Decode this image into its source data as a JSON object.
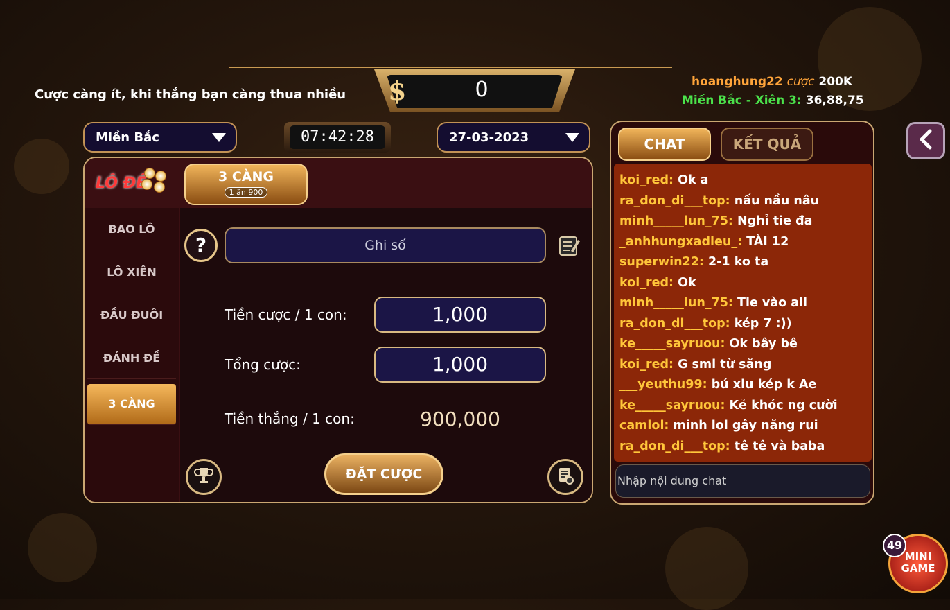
{
  "header": {
    "tagline": "Cược càng ít, khi thắng bạn càng thua nhiều",
    "balance_symbol": "$",
    "balance": "0",
    "ticker": {
      "user": "hoanghung22",
      "bet_word": "cược",
      "bet_amount": "200K",
      "region_line": "Miền Bắc - Xiên 3:",
      "numbers": "36,88,75"
    }
  },
  "controls": {
    "region_selected": "Miền Bắc",
    "timer": "07:42:28",
    "date_selected": "27-03-2023"
  },
  "logo": {
    "text": "LÔ ĐỀ"
  },
  "sidebar": {
    "items": [
      {
        "label": "BAO LÔ",
        "active": false
      },
      {
        "label": "LÔ XIÊN",
        "active": false
      },
      {
        "label": "ĐẦU ĐUÔI",
        "active": false
      },
      {
        "label": "ĐÁNH ĐỀ",
        "active": false
      },
      {
        "label": "3 CÀNG",
        "active": true
      }
    ]
  },
  "bet_panel": {
    "tab_title": "3 CÀNG",
    "tab_subtitle": "1 ăn 900",
    "help_symbol": "?",
    "number_placeholder": "Ghi số",
    "stake_label": "Tiền cược / 1 con:",
    "stake_value": "1,000",
    "total_label": "Tổng cược:",
    "total_value": "1,000",
    "win_label": "Tiền thắng / 1 con:",
    "win_value": "900,000",
    "bet_button": "ĐẶT CƯỢC"
  },
  "chat": {
    "tab_chat": "CHAT",
    "tab_results": "KẾT QUẢ",
    "messages": [
      {
        "user": "koi_red:",
        "text": "Ok a"
      },
      {
        "user": "ra_don_di___top:",
        "text": "nấu nầu nâu"
      },
      {
        "user": "minh_____lun_75:",
        "text": "Nghỉ tie đa"
      },
      {
        "user": "_anhhungxadieu_:",
        "text": "TÀI 12"
      },
      {
        "user": "superwin22:",
        "text": "2-1 ko ta"
      },
      {
        "user": "koi_red:",
        "text": "Ok"
      },
      {
        "user": "minh_____lun_75:",
        "text": "Tie vào all"
      },
      {
        "user": "ra_don_di___top:",
        "text": "kép 7 :))"
      },
      {
        "user": "ke_____sayruou:",
        "text": "Ok bây bê"
      },
      {
        "user": "koi_red:",
        "text": "G sml từ săng"
      },
      {
        "user": "___yeuthu99:",
        "text": "bú xiu kép k Ae"
      },
      {
        "user": "ke_____sayruou:",
        "text": "Kẻ khóc ng cười"
      },
      {
        "user": "camlol:",
        "text": "minh lol gây năng rui"
      },
      {
        "user": "ra_don_di___top:",
        "text": "tê tê và baba"
      }
    ],
    "input_placeholder": "Nhập nội dung chat"
  },
  "mini_game": {
    "badge": "49",
    "line1": "MINI",
    "line2": "GAME"
  },
  "colors": {
    "accent_gold": "#caa772",
    "chat_bg": "#8c2708",
    "user_name": "#ffc63a",
    "ticker_green": "#4be24b",
    "ticker_orange": "#ffa43a"
  }
}
